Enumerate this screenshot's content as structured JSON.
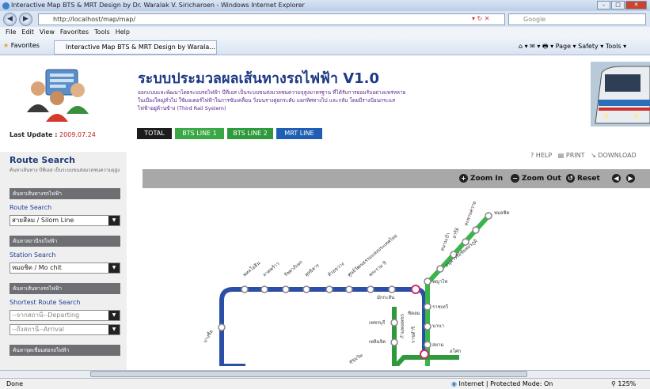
{
  "browser": {
    "title": "Interactive Map BTS & MRT Design by Dr. Waralak V. Siricharoen - Windows Internet Explorer",
    "address": "http://localhost/map/map/",
    "search_placeholder": "Google",
    "menu": [
      "File",
      "Edit",
      "View",
      "Favorites",
      "Tools",
      "Help"
    ],
    "favorites_label": "Favorites",
    "tab_title": "Interactive Map BTS & MRT Design by Warala...",
    "cmd_items": [
      "Page ▾",
      "Safety ▾",
      "Tools ▾"
    ]
  },
  "header": {
    "title": "ระบบประมวลผลเส้นทางรถไฟฟ้า V1.0",
    "desc": "ออกแบบและพัฒนาโดยระบบรถไฟฟ้า บีทีเอส เป็นระบบขนส่งมวลชนความจุสูงมาตรฐาน ที่ได้รับการยอมรับอย่างแพร่หลายในเมืองใหญ่ทั่วไป ใช้มอเตอร์ไฟฟ้าในการขับเคลื่อน วิ่งบนรางคู่ยกระดับ แยกทิศทางไป และกลับ โดยมีรางป้อนกระแสไฟฟ้าอยู่ด้านข้าง (Third Rail System)",
    "last_update_label": "Last Update :",
    "last_update_value": "2009.07.24",
    "tabs": [
      {
        "label": "TOTAL",
        "color": "#1c1c1c"
      },
      {
        "label": "BTS LINE 1",
        "color": "#3aa845"
      },
      {
        "label": "BTS LINE 2",
        "color": "#2f9a3c"
      },
      {
        "label": "MRT LINE",
        "color": "#1f5fb3"
      }
    ]
  },
  "sidebar": {
    "title": "Route Search",
    "subtitle": "ค้นหาเส้นทาง บีทีเอส เป็นระบบขนส่งมวลชนความจุสูง",
    "sections": [
      {
        "bar": "ค้นหาเส้นทางรถไฟฟ้า",
        "label": "Route Search",
        "selects": [
          "สายสีลม / Silom Line"
        ]
      },
      {
        "bar": "ค้นหาสถานีรถไฟฟ้า",
        "label": "Station Search",
        "selects": [
          "หมอชิต / Mo chit"
        ]
      },
      {
        "bar": "ค้นหาเส้นทางรถไฟฟ้า",
        "label": "Shortest Route Search",
        "selects": [
          "--จากสถานี--Departing",
          "--ถึงสถานี--Arrival"
        ]
      },
      {
        "bar": "ค้นหาจุดเชื่อมต่อรถไฟฟ้า",
        "label": "",
        "selects": []
      }
    ]
  },
  "tools": {
    "help": "HELP",
    "print": "PRINT",
    "download": "DOWNLOAD"
  },
  "mapbar": {
    "zoom_in": "Zoom In",
    "zoom_out": "Zoom Out",
    "reset": "Reset"
  },
  "map": {
    "stations_blue": [
      "พหลโยธิน",
      "ลาดพร้าว",
      "รัชดาภิเษก",
      "สุทธิสาร",
      "ห้วยขวาง",
      "ศูนย์วัฒนธรรมแห่งประเทศไทย",
      "พระราม 9"
    ],
    "stations_green": [
      "หมอชิต",
      "สะพานควาย",
      "อารีย์",
      "สนามเป้า",
      "อนุสาวรีย์ชัยสมรภูมิ",
      "พญาไท",
      "ราชเทวี",
      "สยาม"
    ],
    "other_labels": [
      "บางซื่อ",
      "มักกะสัน",
      "เพชรบุรี",
      "นานา",
      "ชิดลม",
      "เพลินจิต",
      "อโศก",
      "สุขุมวิท",
      "กำแพงเพชร",
      "ราชดำริ"
    ]
  },
  "status": {
    "left": "Done",
    "zone": "Internet | Protected Mode: On",
    "zoom": "125%"
  }
}
